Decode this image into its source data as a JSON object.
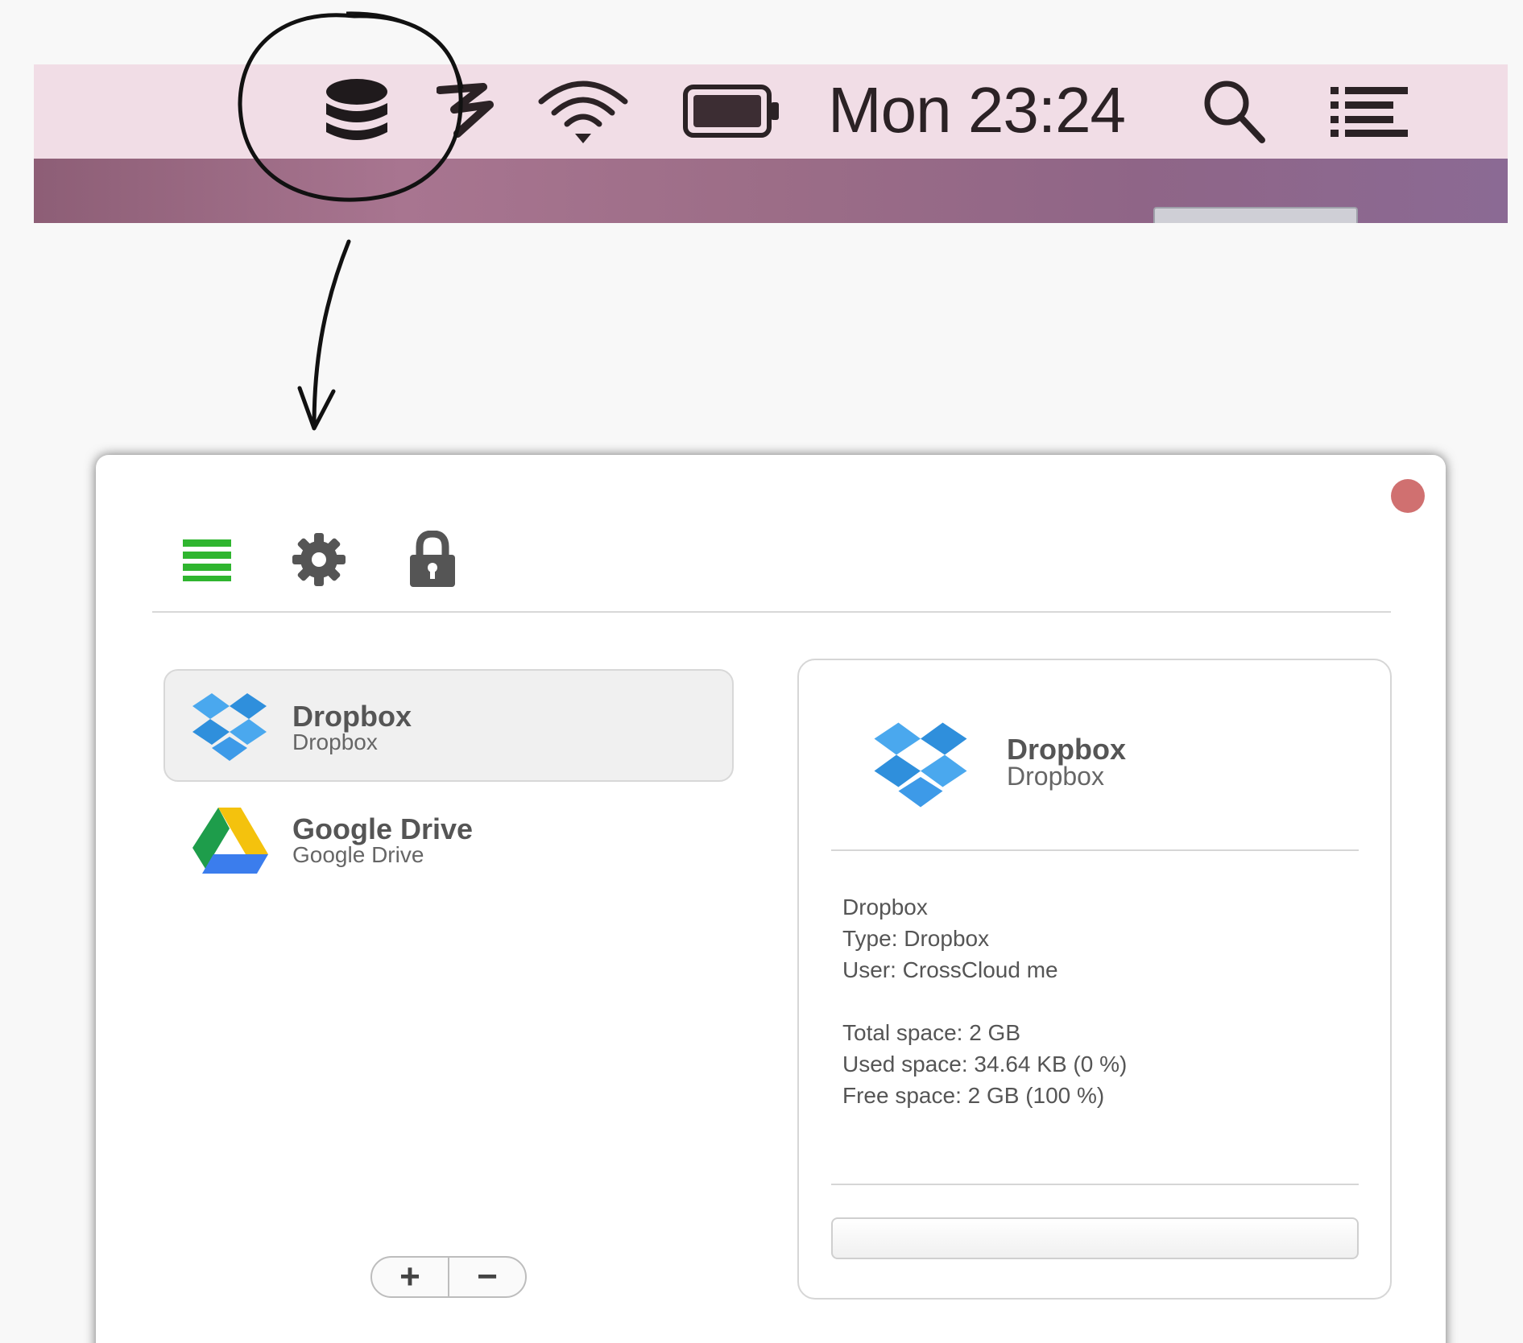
{
  "menubar": {
    "clock": "Mon 23:24",
    "icons": [
      "database-icon",
      "third-party-app-icon",
      "wifi-icon",
      "battery-icon",
      "spotlight-search-icon",
      "notification-list-icon"
    ]
  },
  "toolbar": {
    "icons": [
      "accounts-list-icon",
      "gear-icon",
      "lock-icon"
    ],
    "accent_color": "#2fb52f"
  },
  "accounts": [
    {
      "name": "Dropbox",
      "type": "Dropbox",
      "icon": "dropbox-icon",
      "selected": true
    },
    {
      "name": "Google Drive",
      "type": "Google Drive",
      "icon": "google-drive-icon",
      "selected": false
    }
  ],
  "list_controls": {
    "add": "+",
    "remove": "−"
  },
  "detail": {
    "name": "Dropbox",
    "type": "Dropbox",
    "info": {
      "account": "Dropbox",
      "type_line": "Type: Dropbox",
      "user_line": "User: CrossCloud me",
      "total_line": "Total space: 2 GB",
      "used_line": "Used space: 34.64 KB (0 %)",
      "free_line": "Free space: 2 GB (100 %)"
    }
  },
  "colors": {
    "menubar_bg": "#f1dde6",
    "close_button": "#d07070",
    "dropbox_blue": "#3d9ae8"
  }
}
